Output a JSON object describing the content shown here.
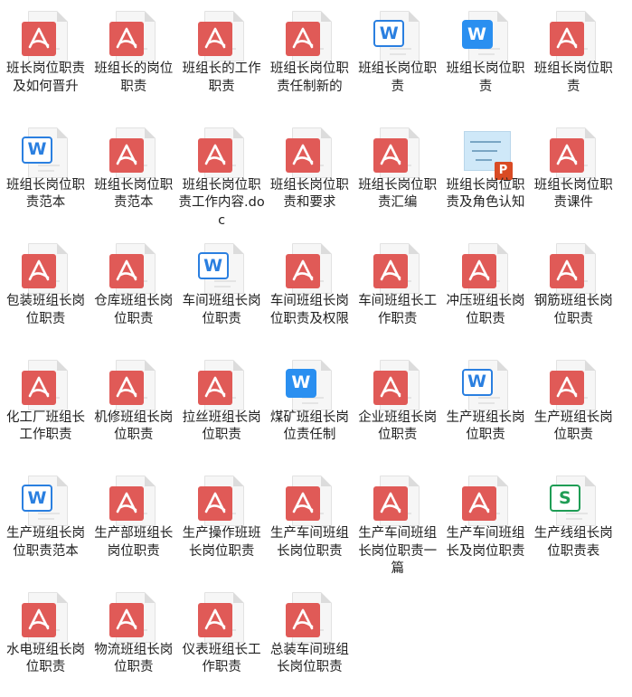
{
  "colors": {
    "pdf": "#e05a57",
    "word": "#2a7fe0",
    "word_solid": "#2a8ff0",
    "sheet": "#1f9d55",
    "ppt": "#d94b24"
  },
  "files": [
    {
      "label": "班长岗位职责及如何晋升",
      "icon": "pdf-icon",
      "type": "pdf"
    },
    {
      "label": "班组长的岗位职责",
      "icon": "pdf-icon",
      "type": "pdf"
    },
    {
      "label": "班组长的工作职责",
      "icon": "pdf-icon",
      "type": "pdf"
    },
    {
      "label": "班组长岗位职责任制新的",
      "icon": "pdf-icon",
      "type": "pdf"
    },
    {
      "label": "班组长岗位职责",
      "icon": "word-icon",
      "type": "word"
    },
    {
      "label": "班组长岗位职责",
      "icon": "word-icon",
      "type": "word-solid"
    },
    {
      "label": "班组长岗位职责",
      "icon": "pdf-icon",
      "type": "pdf"
    },
    {
      "label": "班组长岗位职责范本",
      "icon": "word-icon",
      "type": "word"
    },
    {
      "label": "班组长岗位职责范本",
      "icon": "pdf-icon",
      "type": "pdf"
    },
    {
      "label": "班组长岗位职责工作内容.doc",
      "icon": "pdf-icon",
      "type": "pdf"
    },
    {
      "label": "班组长岗位职责和要求",
      "icon": "pdf-icon",
      "type": "pdf"
    },
    {
      "label": "班组长岗位职责汇编",
      "icon": "pdf-icon",
      "type": "pdf"
    },
    {
      "label": "班组长岗位职责及角色认知",
      "icon": "ppt-thumbnail-icon",
      "type": "ppt"
    },
    {
      "label": "班组长岗位职责课件",
      "icon": "pdf-icon",
      "type": "pdf"
    },
    {
      "label": "包装班组长岗位职责",
      "icon": "pdf-icon",
      "type": "pdf"
    },
    {
      "label": "仓库班组长岗位职责",
      "icon": "pdf-icon",
      "type": "pdf"
    },
    {
      "label": "车间班组长岗位职责",
      "icon": "word-icon",
      "type": "word"
    },
    {
      "label": "车间班组长岗位职责及权限",
      "icon": "pdf-icon",
      "type": "pdf"
    },
    {
      "label": "车间班组长工作职责",
      "icon": "pdf-icon",
      "type": "pdf"
    },
    {
      "label": "冲压班组长岗位职责",
      "icon": "pdf-icon",
      "type": "pdf"
    },
    {
      "label": "钢筋班组长岗位职责",
      "icon": "pdf-icon",
      "type": "pdf"
    },
    {
      "label": "化工厂班组长工作职责",
      "icon": "pdf-icon",
      "type": "pdf"
    },
    {
      "label": "机修班组长岗位职责",
      "icon": "pdf-icon",
      "type": "pdf"
    },
    {
      "label": "拉丝班组长岗位职责",
      "icon": "pdf-icon",
      "type": "pdf"
    },
    {
      "label": "煤矿班组长岗位责任制",
      "icon": "word-icon",
      "type": "word-solid"
    },
    {
      "label": "企业班组长岗位职责",
      "icon": "pdf-icon",
      "type": "pdf"
    },
    {
      "label": "生产班组长岗位职责",
      "icon": "word-icon",
      "type": "word"
    },
    {
      "label": "生产班组长岗位职责",
      "icon": "pdf-icon",
      "type": "pdf"
    },
    {
      "label": "生产班组长岗位职责范本",
      "icon": "word-icon",
      "type": "word"
    },
    {
      "label": "生产部班组长岗位职责",
      "icon": "pdf-icon",
      "type": "pdf"
    },
    {
      "label": "生产操作班班长岗位职责",
      "icon": "pdf-icon",
      "type": "pdf"
    },
    {
      "label": "生产车间班组长岗位职责",
      "icon": "pdf-icon",
      "type": "pdf"
    },
    {
      "label": "生产车间班组长岗位职责一篇",
      "icon": "pdf-icon",
      "type": "pdf"
    },
    {
      "label": "生产车间班组长及岗位职责",
      "icon": "pdf-icon",
      "type": "pdf"
    },
    {
      "label": "生产线组长岗位职责表",
      "icon": "spreadsheet-icon",
      "type": "sheet"
    },
    {
      "label": "水电班组长岗位职责",
      "icon": "pdf-icon",
      "type": "pdf"
    },
    {
      "label": "物流班组长岗位职责",
      "icon": "pdf-icon",
      "type": "pdf"
    },
    {
      "label": "仪表班组长工作职责",
      "icon": "pdf-icon",
      "type": "pdf"
    },
    {
      "label": "总装车间班组长岗位职责",
      "icon": "pdf-icon",
      "type": "pdf"
    }
  ]
}
